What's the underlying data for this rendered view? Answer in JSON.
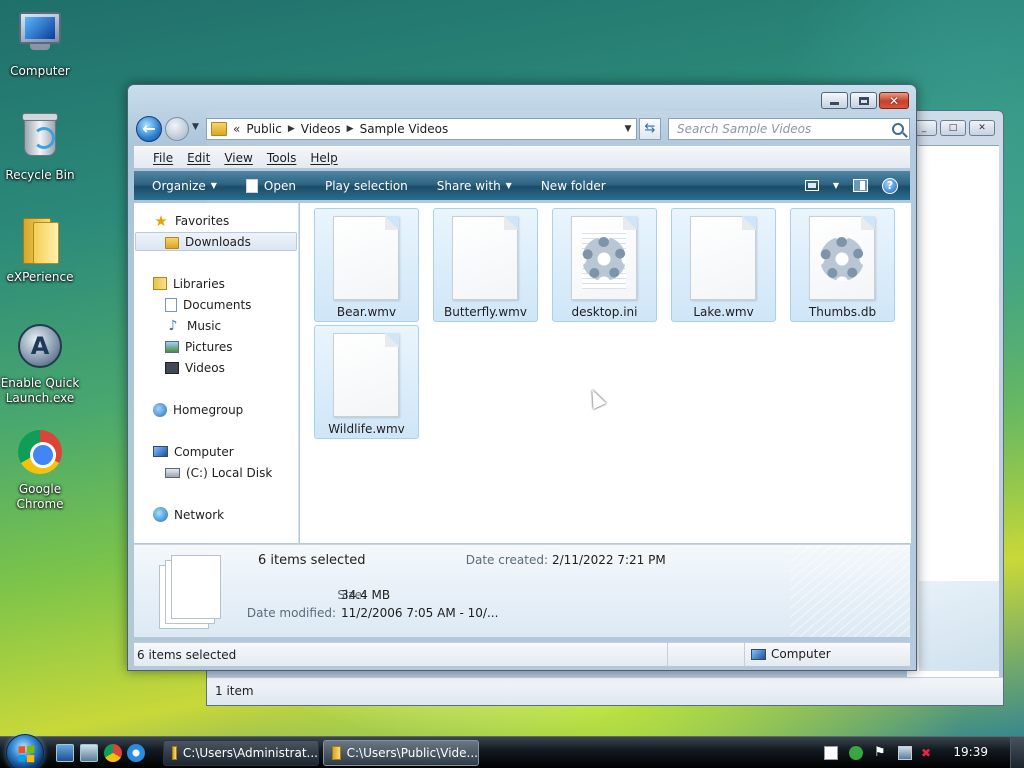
{
  "desktop": {
    "icons": [
      {
        "label": "Computer",
        "icon": "computer-icon"
      },
      {
        "label": "Recycle Bin",
        "icon": "recycle-bin-icon"
      },
      {
        "label": "eXPerience",
        "icon": "folder-icon"
      },
      {
        "label": "Enable Quick Launch.exe",
        "icon": "quick-launch-icon"
      },
      {
        "label": "Google Chrome",
        "icon": "chrome-icon"
      }
    ]
  },
  "back_window": {
    "status": "1 item"
  },
  "window": {
    "address": {
      "crumbs": [
        "Public",
        "Videos",
        "Sample Videos"
      ]
    },
    "search_placeholder": "Search Sample Videos",
    "menu": [
      "File",
      "Edit",
      "View",
      "Tools",
      "Help"
    ],
    "commands": {
      "organize": "Organize",
      "open": "Open",
      "play_selection": "Play selection",
      "share_with": "Share with",
      "new_folder": "New folder"
    },
    "nav": {
      "favorites": "Favorites",
      "downloads": "Downloads",
      "libraries": "Libraries",
      "documents": "Documents",
      "music": "Music",
      "pictures": "Pictures",
      "videos": "Videos",
      "homegroup": "Homegroup",
      "computer": "Computer",
      "local_disk": "(C:) Local Disk",
      "network": "Network"
    },
    "files": [
      {
        "name": "Bear.wmv",
        "type": "document"
      },
      {
        "name": "Butterfly.wmv",
        "type": "document"
      },
      {
        "name": "desktop.ini",
        "type": "settings"
      },
      {
        "name": "Lake.wmv",
        "type": "document"
      },
      {
        "name": "Thumbs.db",
        "type": "settings"
      },
      {
        "name": "Wildlife.wmv",
        "type": "document"
      }
    ],
    "details": {
      "count": "6 items selected",
      "size_label": "Size:",
      "size": "34.4 MB",
      "modified_label": "Date modified:",
      "modified": "11/2/2006 7:05 AM - 10/...",
      "created_label": "Date created:",
      "created": "2/11/2022 7:21 PM"
    },
    "status": {
      "left": "6 items selected",
      "right": "Computer"
    }
  },
  "taskbar": {
    "tasks": [
      {
        "label": "C:\\Users\\Administrat..."
      },
      {
        "label": "C:\\Users\\Public\\Vide..."
      }
    ],
    "clock": "19:39"
  }
}
